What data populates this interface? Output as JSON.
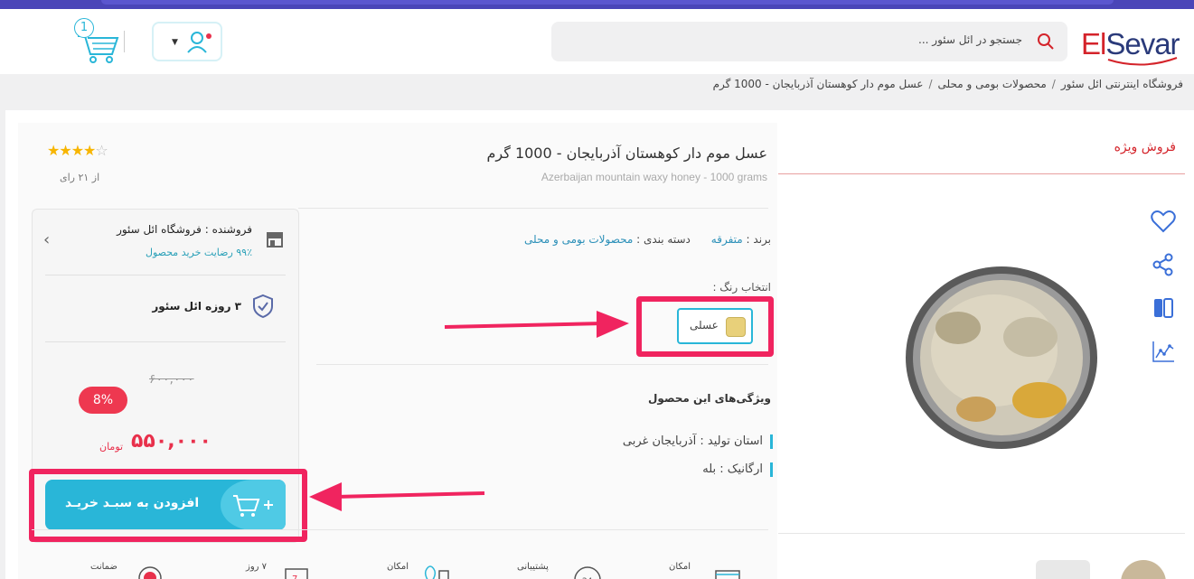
{
  "header": {
    "logo": {
      "prefix": "El",
      "suffix": "Sevar"
    },
    "search_placeholder": "جستجو در ائل سئور ...",
    "cart_count": "1"
  },
  "breadcrumb": [
    "فروشگاه اینترنتی ائل سئور",
    "محصولات بومی و محلی",
    "عسل موم دار کوهستان آذربایجان - 1000 گرم"
  ],
  "sidebar": {
    "special_sale": "فروش ویژه"
  },
  "product": {
    "title": "عسل موم دار کوهستان آذربایجان - 1000 گرم",
    "subtitle": "Azerbaijan mountain waxy honey - 1000 grams",
    "rating_stars": 4,
    "rating_count_label": "از ۲۱ رای",
    "brand_label": "برند :",
    "brand_value": "متفرقه",
    "category_label": "دسته بندی :",
    "category_value": "محصولات بومی و محلی",
    "color_title": "انتخاب رنگ :",
    "color_option": "عسلی",
    "features_title": "ویژگی‌های این محصول",
    "features": [
      "استان تولید : آذربایجان غربی",
      "ارگانیک : بله"
    ]
  },
  "seller": {
    "name": "فروشنده : فروشگاه ائل سئور",
    "satisfaction": "۹۹٪ رضایت خرید محصول",
    "shipping": "۳ روزه ائل سئور",
    "old_price": "۶۰۰,۰۰۰",
    "discount": "8%",
    "price": "۵۵۰,۰۰۰",
    "currency": "تومان",
    "add_to_cart": "افزودن به سبـد خریـد"
  },
  "bottom_features": [
    "امکان",
    "پشتیبانی",
    "امکان",
    "۷ روز",
    "ضمانت"
  ],
  "colors": {
    "accent": "#29b6d8",
    "sale": "#e8304b",
    "highlight": "#f0245f"
  }
}
